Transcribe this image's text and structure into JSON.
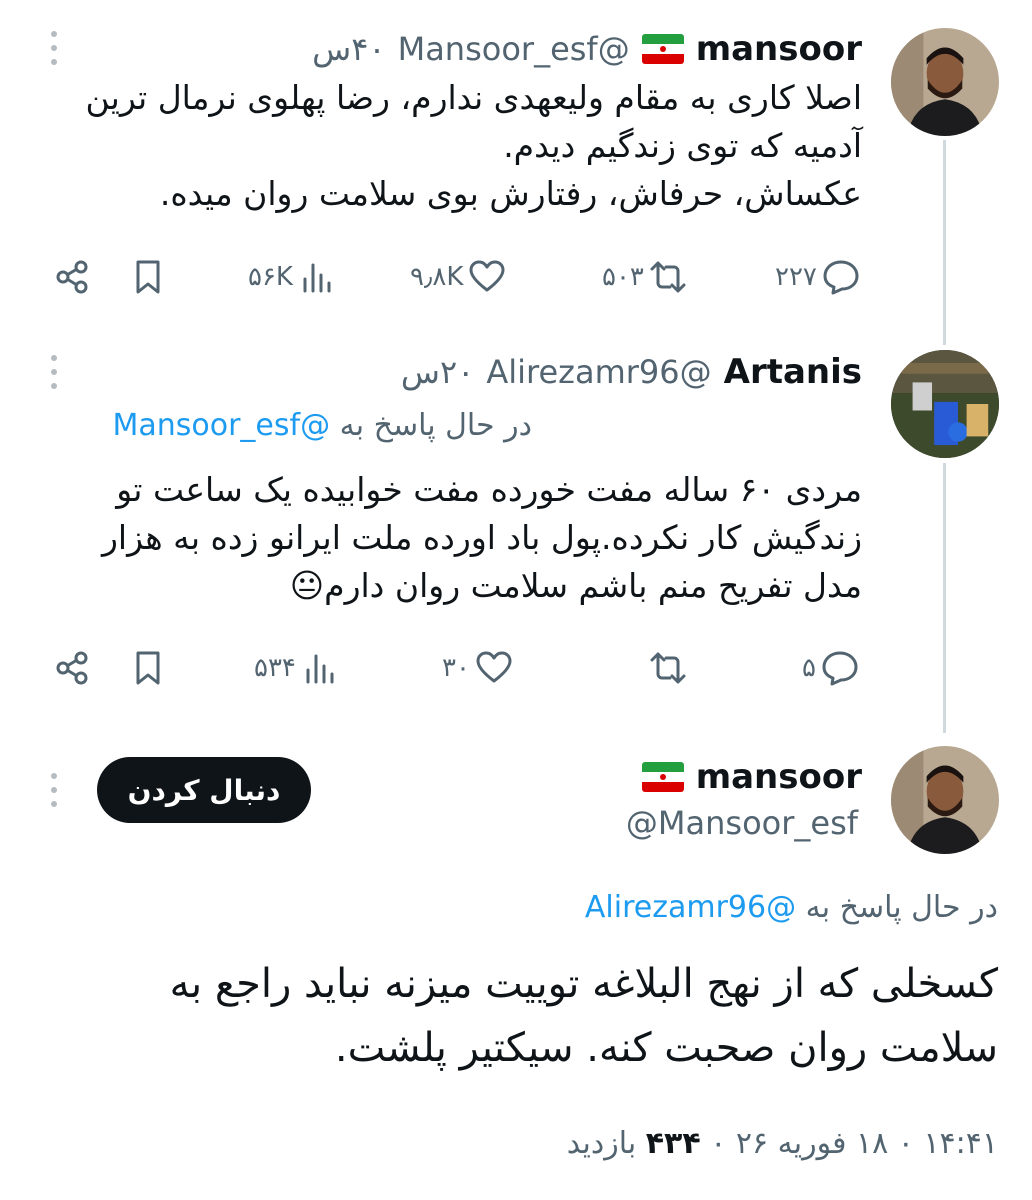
{
  "tweet1": {
    "name": "mansoor",
    "flag": "iran-flag",
    "handle": "@Mansoor_esf",
    "time": "۴۰س",
    "text_lines": [
      "اصلا کاری به مقام ولیعهدی ندارم، رضا پهلوی نرمال ترین",
      "آدمیه که توی زندگیم دیدم.",
      "عکساش، حرفاش، رفتارش بوی سلامت روان میده."
    ],
    "replies": "۲۲۷",
    "retweets": "۵۰۳",
    "likes": "۹٫۸K",
    "views": "۵۶K"
  },
  "tweet2": {
    "name": "Artanis",
    "handle": "@Alirezamr96",
    "time": "۲۰س",
    "replying_prefix": "در حال پاسخ به",
    "replying_to": "@Mansoor_esf",
    "text_lines": [
      "مردی ۶۰ ساله مفت خورده مفت خوابیده یک ساعت تو",
      "زندگیش کار نکرده.پول باد اورده ملت ایرانو زده به هزار",
      "مدل تفریح منم باشم سلامت روان دارم😐"
    ],
    "replies": "۵",
    "retweets": "",
    "likes": "۳۰",
    "views": "۵۳۴"
  },
  "main_tweet": {
    "name": "mansoor",
    "flag": "iran-flag",
    "handle": "@Mansoor_esf",
    "follow_label": "دنبال کردن",
    "replying_prefix": "در حال پاسخ به",
    "replying_to": "@Alirezamr96",
    "text_lines": [
      "کسخلی که از نهج البلاغه توییت میزنه نباید راجع به",
      "سلامت روان صحبت کنه. سیکتیر پلشت."
    ],
    "meta_time_date": "۱۴:۴۱ ۰ ۱۸ فوریه ۲۶ ۰",
    "meta_views": "۴۳۴",
    "meta_views_label": "بازدید"
  },
  "colors": {
    "text": "#0f1419",
    "secondary": "#536471",
    "link": "#1d9bf0",
    "thread_line": "#cfd9de",
    "follow_bg": "#0f1419"
  }
}
